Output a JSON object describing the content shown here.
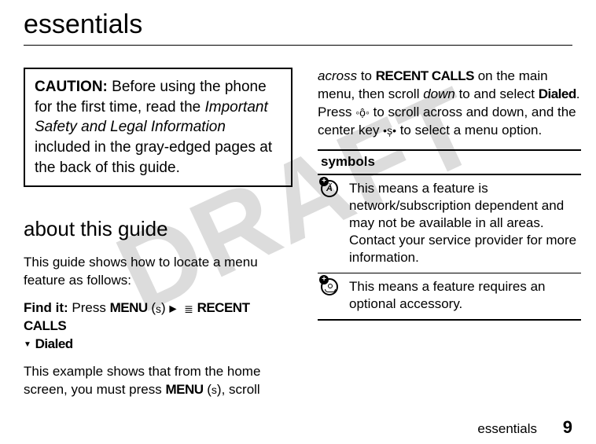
{
  "watermark": "DRAFT",
  "title": "essentials",
  "caution": {
    "label": "CAUTION:",
    "before": " Before using the phone for the first time, read the ",
    "italic": "Important Safety and Legal Information",
    "after": " included in the gray-edged pages at the back of this guide."
  },
  "about": {
    "heading": "about this guide",
    "intro": "This guide shows how to locate a menu feature as follows:",
    "findit_label": "Find it:",
    "findit_press": " Press ",
    "menu_word": "MENU",
    "paren_s": " (",
    "s_glyph": "s",
    "paren_close": ") ",
    "arrow": "▶",
    "recent_icon": "≣",
    "recent_calls": "RECENT CALLS",
    "tri_down": "▼",
    "dialed_lead": " ",
    "dialed": "Dialed",
    "example_line1": "This example shows that from the home screen, you must press ",
    "menu_word2": "MENU",
    "example_tail": "), scroll"
  },
  "right": {
    "p1_a": "across",
    "p1_b": " to ",
    "p1_recent": "RECENT CALLS",
    "p1_c": " on the main menu, then scroll ",
    "p1_d": "down",
    "p1_e": " to and select ",
    "p1_dialed": "Dialed",
    "p1_f": ". Press ",
    "nav_glyph": "◦ộ◦",
    "p1_g": " to scroll across and down, and the center key ",
    "center_glyph": "•ș•",
    "p1_h": " to select a menu option."
  },
  "symbols": {
    "header": "symbols",
    "rows": [
      {
        "icon": "network",
        "text": "This means a feature is network/subscription dependent and may not be available in all areas. Contact your service provider for more information."
      },
      {
        "icon": "accessory",
        "text": "This means a feature requires an optional accessory."
      }
    ]
  },
  "footer": {
    "label": "essentials",
    "page": "9"
  }
}
